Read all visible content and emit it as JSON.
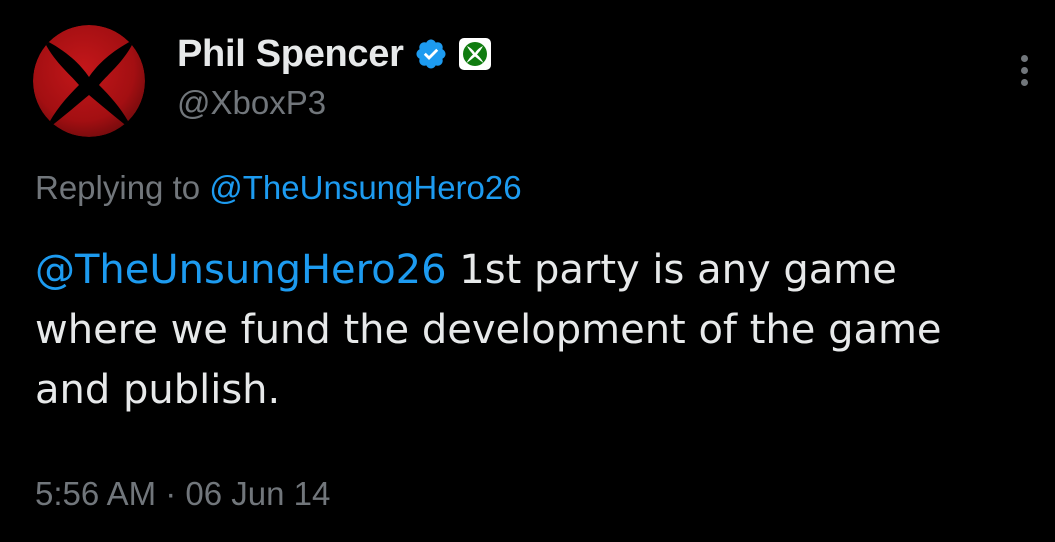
{
  "author": {
    "avatar_icon": "xbox-logo-icon",
    "display_name": "Phil Spencer",
    "handle": "@XboxP3",
    "verified_icon": "verified-badge-icon",
    "affiliate_icon": "xbox-affiliate-badge-icon"
  },
  "menu": {
    "icon": "more-options-icon"
  },
  "reply": {
    "prefix": "Replying to ",
    "to": "@TheUnsungHero26"
  },
  "tweet": {
    "mention": "@TheUnsungHero26",
    "text": " 1st party is any game where we fund the development of the game and publish."
  },
  "timestamp": "5:56 AM · 06 Jun 14",
  "colors": {
    "background": "#000000",
    "text": "#e7e9ea",
    "secondary": "#71767b",
    "link": "#1d9bf0",
    "verified": "#1d9bf0",
    "xbox_green": "#107c10",
    "avatar_red": "#a30f12"
  }
}
